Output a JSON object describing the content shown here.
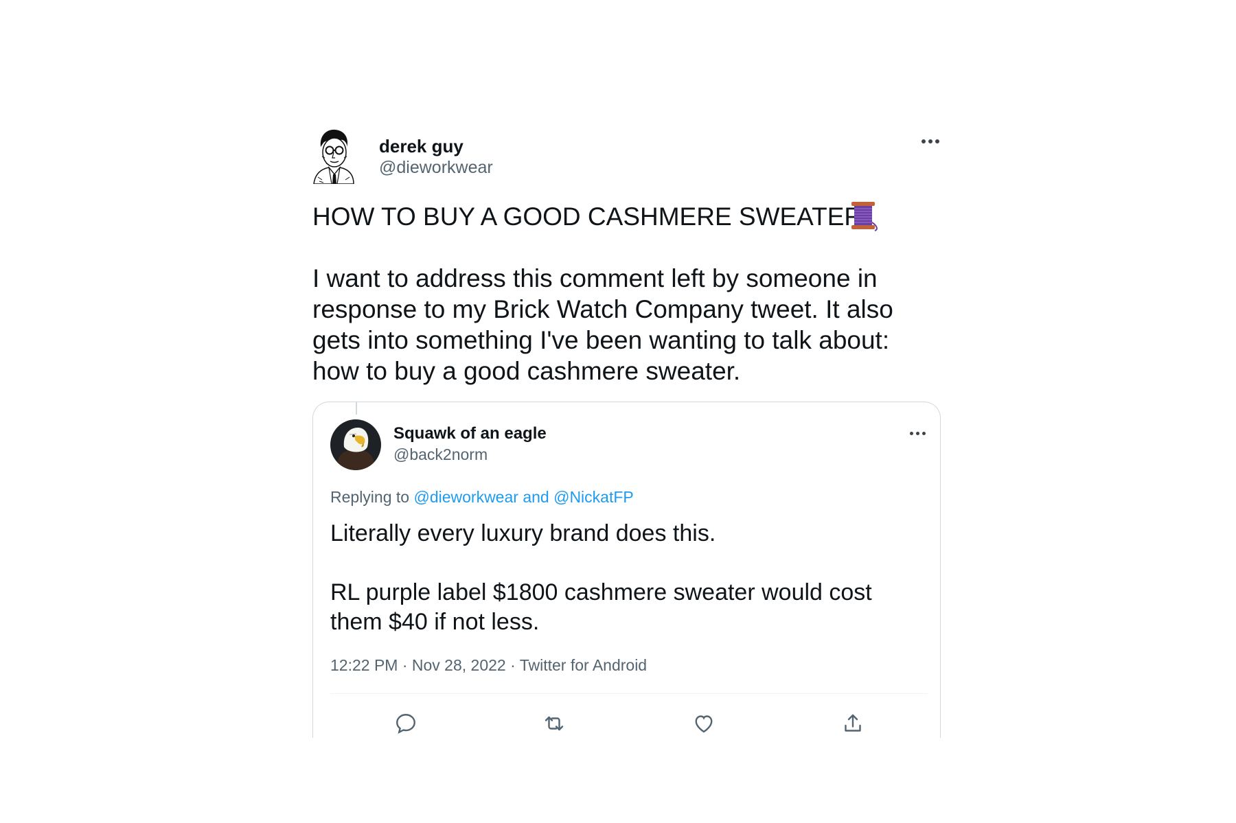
{
  "tweet": {
    "author_name": "derek guy",
    "author_handle": "@dieworkwear",
    "avatar": "sketch-portrait-avatar",
    "more_icon": "more-horizontal-icon",
    "text": "HOW TO BUY A GOOD CASHMERE SWEATER\n\nI want to address this comment left by someone in response to my Brick Watch Company tweet. It also gets into something I've been wanting to talk about: how to buy a good cashmere sweater.",
    "emoji": "thread-spool-emoji"
  },
  "quoted_tweet": {
    "author_name": "Squawk of an eagle",
    "author_handle": "@back2norm",
    "avatar": "bald-eagle-avatar",
    "replying_prefix": "Replying to ",
    "replying_to_1": "@dieworkwear",
    "replying_and": " and ",
    "replying_to_2": "@NickatFP",
    "text": "Literally every luxury brand does this.\n\nRL purple label $1800 cashmere sweater would cost them $40 if not less.",
    "meta": "12:22 PM · Nov 28, 2022 · Twitter for Android",
    "actions": [
      "reply-icon",
      "retweet-icon",
      "like-icon",
      "share-icon"
    ]
  },
  "colors": {
    "text": "#0f1419",
    "secondary": "#536471",
    "link": "#1d9bf0",
    "border": "#cfd9de"
  }
}
